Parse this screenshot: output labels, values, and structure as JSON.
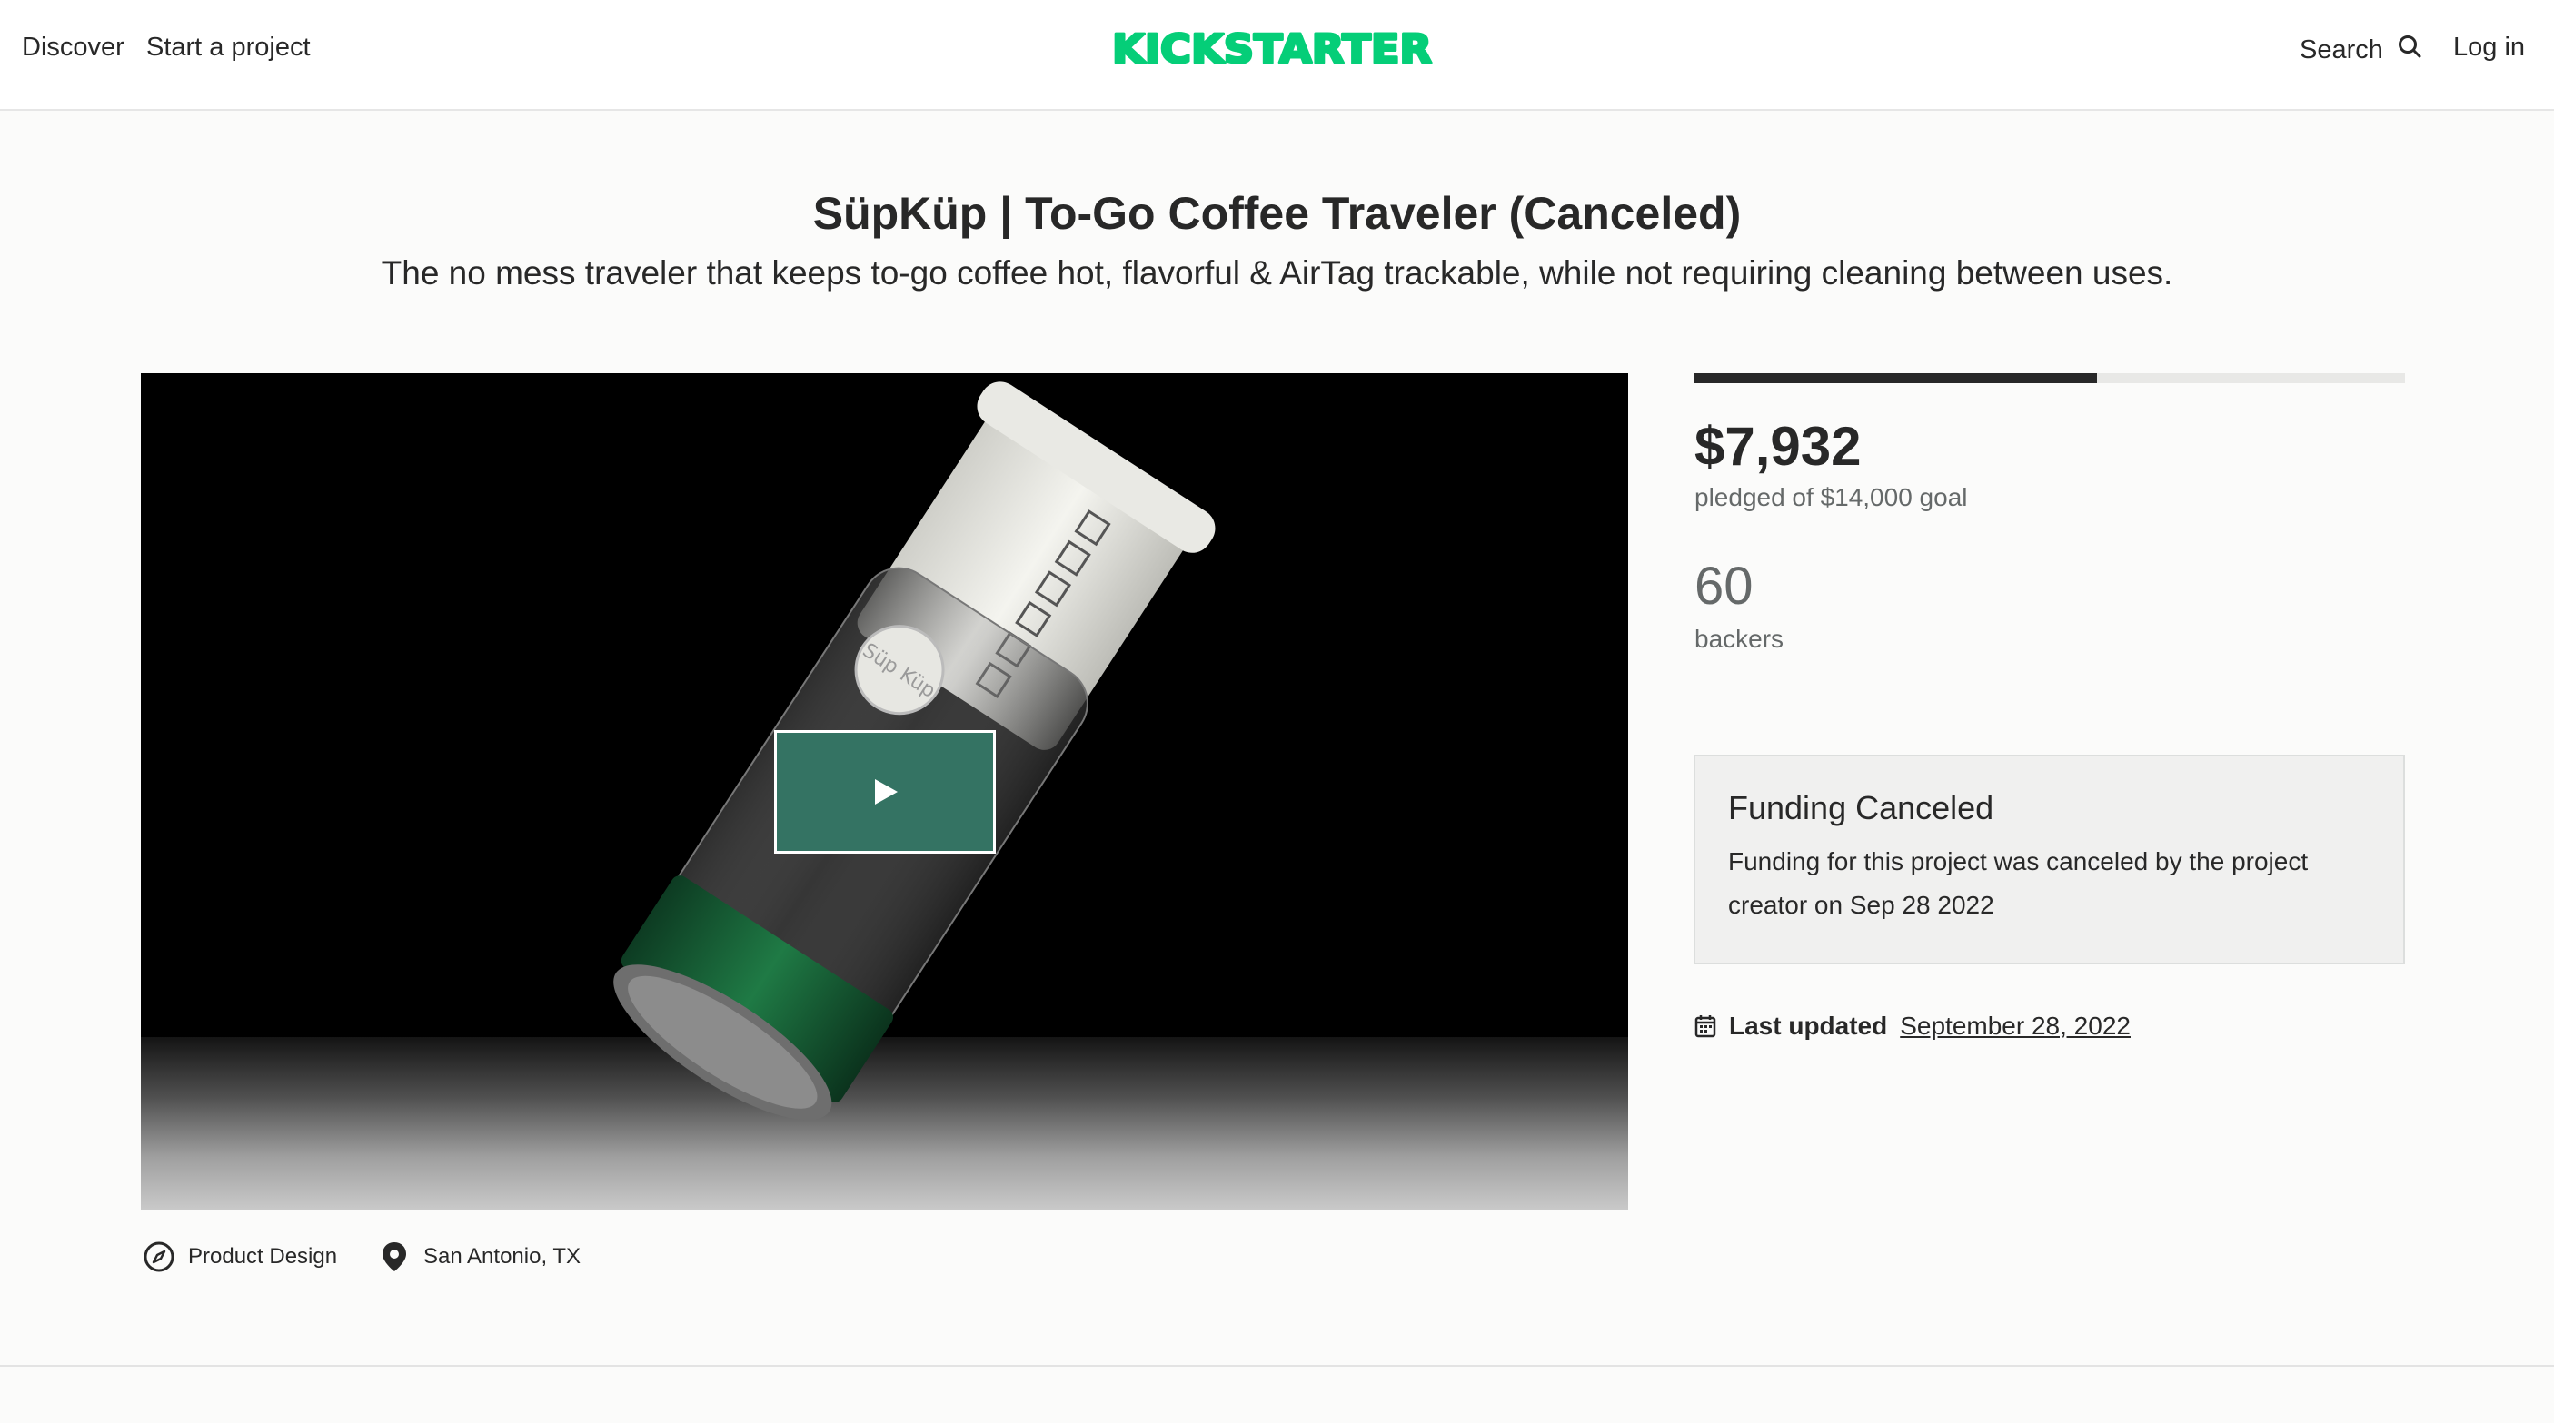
{
  "header": {
    "discover_label": "Discover",
    "start_project_label": "Start a project",
    "logo_text": "KICKSTARTER",
    "search_label": "Search",
    "login_label": "Log in"
  },
  "project": {
    "title": "SüpKüp | To-Go Coffee Traveler (Canceled)",
    "blurb": "The no mess traveler that keeps to-go coffee hot, flavorful & AirTag trackable, while not requiring cleaning between uses.",
    "cup_brand_text": "Süp Küp",
    "category": "Product Design",
    "location": "San Antonio, TX"
  },
  "stats": {
    "pledged": "$7,932",
    "goal_text": "pledged of $14,000 goal",
    "funded_fraction": 0.5666,
    "backers_count": "60",
    "backers_label": "backers"
  },
  "status_box": {
    "title": "Funding Canceled",
    "text": "Funding for this project was canceled by the project creator on Sep 28 2022"
  },
  "updated": {
    "label": "Last updated",
    "date": "September 28, 2022"
  },
  "icons": {
    "search": "search-icon",
    "play": "play-icon",
    "compass": "compass-icon",
    "location": "location-pin-icon",
    "calendar": "calendar-icon"
  },
  "colors": {
    "brand_green": "#05ce78",
    "play_button": "#347363",
    "progress_fill": "#282828",
    "progress_track": "#e8e8e6"
  }
}
